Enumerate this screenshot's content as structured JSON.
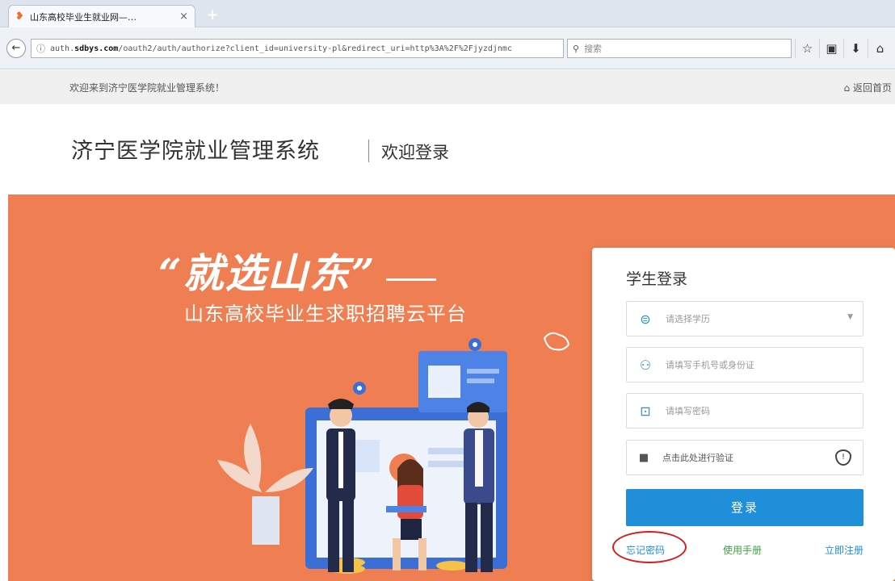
{
  "browser": {
    "tab_title": "山东高校毕业生就业网—…",
    "tab_close": "×",
    "new_tab": "+",
    "back": "←",
    "url_prefix": "auth.",
    "url_host": "sdbys.com",
    "url_path": "/oauth2/auth/authorize?client_id=university-pl&redirect_uri=http%3A%2F%2Fjyzdjnmc",
    "search_placeholder": "搜索",
    "toolbar_icons": [
      "star-icon",
      "bookmarks-icon",
      "download-icon",
      "home-icon"
    ]
  },
  "site": {
    "welcome_text": "欢迎来到济宁医学院就业管理系统！",
    "home_link": "返回首页",
    "system_title": "济宁医学院就业管理系统",
    "welcome_login": "欢迎登录"
  },
  "banner": {
    "slogan": "“就选山东”",
    "subslogan": "山东高校毕业生求职招聘云平台",
    "bg_color": "#ef7f52"
  },
  "login": {
    "title": "学生登录",
    "education_select": "请选择学历",
    "user_placeholder": "请填写手机号或身份证",
    "password_placeholder": "请填写密码",
    "verify_text": "点击此处进行验证",
    "login_button": "登录",
    "forgot_password": "忘记密码",
    "user_manual": "使用手册",
    "register": "立即注册",
    "accent_color": "#1f8fd9"
  }
}
